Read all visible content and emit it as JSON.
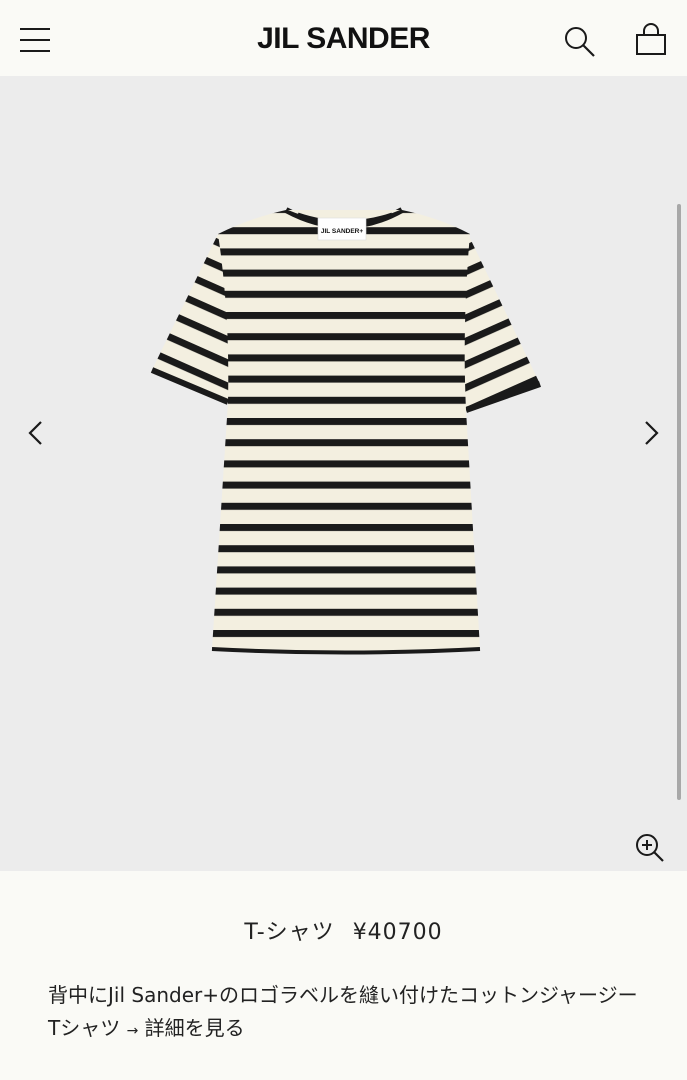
{
  "header": {
    "brand": "JIL SANDER",
    "icons": [
      "hamburger-menu-icon",
      "search-icon",
      "shopping-bag-icon"
    ]
  },
  "gallery": {
    "icons": [
      "chevron-left-icon",
      "chevron-right-icon",
      "zoom-in-icon"
    ],
    "product_label_text": "JIL SANDER+"
  },
  "product": {
    "name": "T-シャツ",
    "price": "¥40700",
    "description": "背中にJil Sander+のロゴラベルを縫い付けたコットンジャージーTシャツ",
    "details_arrow": "→",
    "details_link": "詳細を見る"
  },
  "colors": {
    "page_bg": "#fafaf6",
    "gallery_bg": "#ececec",
    "stripe_dark": "#1a1a1a",
    "stripe_light": "#f3efe0"
  }
}
